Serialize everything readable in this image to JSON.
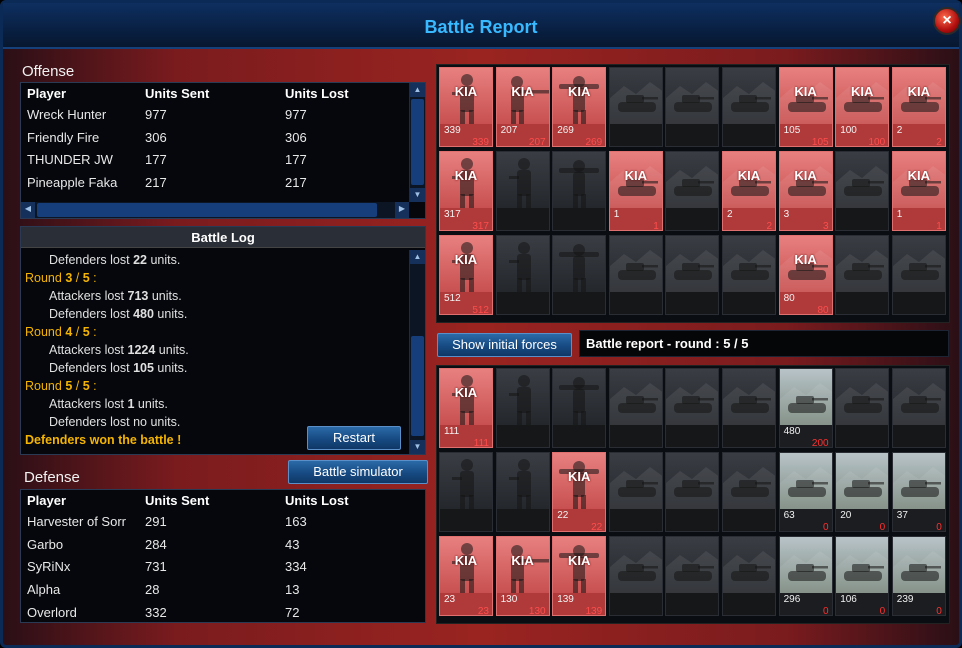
{
  "window": {
    "title": "Battle Report",
    "close_label": "×"
  },
  "offense": {
    "label": "Offense",
    "columns": [
      "Player",
      "Units Sent",
      "Units Lost"
    ],
    "rows": [
      [
        "Wreck Hunter",
        "977",
        "977"
      ],
      [
        "Friendly Fire",
        "306",
        "306"
      ],
      [
        "THUNDER JW",
        "177",
        "177"
      ],
      [
        "Pineapple Faka",
        "217",
        "217"
      ]
    ]
  },
  "battle_log": {
    "title": "Battle Log",
    "lines": [
      {
        "kind": "ind",
        "pre": "Defenders lost ",
        "num": "22",
        "post": " units."
      },
      {
        "kind": "rnd",
        "pre": "Round ",
        "num": "3",
        "mid": " / ",
        "num2": "5",
        "post": " :"
      },
      {
        "kind": "ind",
        "pre": "Attackers lost ",
        "num": "713",
        "post": " units."
      },
      {
        "kind": "ind",
        "pre": "Defenders lost ",
        "num": "480",
        "post": " units."
      },
      {
        "kind": "rnd",
        "pre": "Round ",
        "num": "4",
        "mid": " / ",
        "num2": "5",
        "post": " :"
      },
      {
        "kind": "ind",
        "pre": "Attackers lost ",
        "num": "1224",
        "post": " units."
      },
      {
        "kind": "ind",
        "pre": "Defenders lost ",
        "num": "105",
        "post": " units."
      },
      {
        "kind": "rnd",
        "pre": "Round ",
        "num": "5",
        "mid": " / ",
        "num2": "5",
        "post": " :"
      },
      {
        "kind": "ind",
        "pre": "Attackers lost ",
        "num": "1",
        "post": " units."
      },
      {
        "kind": "ind",
        "pre": "Defenders lost no units.",
        "num": "",
        "post": ""
      },
      {
        "kind": "win",
        "pre": "Defenders won the battle !",
        "num": "",
        "post": ""
      }
    ],
    "restart_label": "Restart"
  },
  "battle_simulator_label": "Battle simulator",
  "defense": {
    "label": "Defense",
    "columns": [
      "Player",
      "Units Sent",
      "Units Lost"
    ],
    "rows": [
      [
        "Harvester of Sorr",
        "291",
        "163"
      ],
      [
        "Garbo",
        "284",
        "43"
      ],
      [
        "SyRiNx",
        "731",
        "334"
      ],
      [
        "Alpha",
        "28",
        "13"
      ],
      [
        "Overlord",
        "332",
        "72"
      ]
    ]
  },
  "show_initial_label": "Show initial forces",
  "report_title": "Battle report - round : 5 / 5",
  "kia_label": "KIA",
  "attacker_units": [
    {
      "type": "infantry",
      "kia": true,
      "total": "339",
      "lost": "339"
    },
    {
      "type": "rifle",
      "kia": true,
      "total": "207",
      "lost": "207"
    },
    {
      "type": "rocket",
      "kia": true,
      "total": "269",
      "lost": "269"
    },
    {
      "type": "tank",
      "kia": false,
      "total": "",
      "lost": ""
    },
    {
      "type": "tank",
      "kia": false,
      "total": "",
      "lost": ""
    },
    {
      "type": "tank",
      "kia": false,
      "total": "",
      "lost": ""
    },
    {
      "type": "tank",
      "kia": true,
      "total": "105",
      "lost": "105"
    },
    {
      "type": "tank",
      "kia": true,
      "total": "100",
      "lost": "100"
    },
    {
      "type": "tank",
      "kia": true,
      "total": "2",
      "lost": "2"
    },
    {
      "type": "infantry",
      "kia": true,
      "total": "317",
      "lost": "317"
    },
    {
      "type": "infantry",
      "kia": false,
      "total": "",
      "lost": ""
    },
    {
      "type": "rocket",
      "kia": false,
      "total": "",
      "lost": ""
    },
    {
      "type": "tank",
      "kia": true,
      "total": "1",
      "lost": "1"
    },
    {
      "type": "tank",
      "kia": false,
      "total": "",
      "lost": ""
    },
    {
      "type": "tank",
      "kia": true,
      "total": "2",
      "lost": "2"
    },
    {
      "type": "tank",
      "kia": true,
      "total": "3",
      "lost": "3"
    },
    {
      "type": "tank",
      "kia": false,
      "total": "",
      "lost": ""
    },
    {
      "type": "tank",
      "kia": true,
      "total": "1",
      "lost": "1"
    },
    {
      "type": "infantry",
      "kia": true,
      "total": "512",
      "lost": "512"
    },
    {
      "type": "infantry",
      "kia": false,
      "total": "",
      "lost": ""
    },
    {
      "type": "rocket",
      "kia": false,
      "total": "",
      "lost": ""
    },
    {
      "type": "tank",
      "kia": false,
      "total": "",
      "lost": ""
    },
    {
      "type": "tank",
      "kia": false,
      "total": "",
      "lost": ""
    },
    {
      "type": "tank",
      "kia": false,
      "total": "",
      "lost": ""
    },
    {
      "type": "tank",
      "kia": true,
      "total": "80",
      "lost": "80"
    },
    {
      "type": "tank",
      "kia": false,
      "total": "",
      "lost": ""
    },
    {
      "type": "tank",
      "kia": false,
      "total": "",
      "lost": ""
    }
  ],
  "defender_units": [
    {
      "type": "infantry",
      "kia": true,
      "total": "111",
      "lost": "111"
    },
    {
      "type": "infantry",
      "kia": false,
      "total": "",
      "lost": ""
    },
    {
      "type": "rocket",
      "kia": false,
      "total": "",
      "lost": ""
    },
    {
      "type": "tank",
      "kia": false,
      "total": "",
      "lost": ""
    },
    {
      "type": "tank",
      "kia": false,
      "total": "",
      "lost": ""
    },
    {
      "type": "tank",
      "kia": false,
      "total": "",
      "lost": ""
    },
    {
      "type": "tank",
      "kia": false,
      "alive": true,
      "total": "480",
      "lost": "200"
    },
    {
      "type": "tank",
      "kia": false,
      "total": "",
      "lost": ""
    },
    {
      "type": "tank",
      "kia": false,
      "total": "",
      "lost": ""
    },
    {
      "type": "infantry",
      "kia": false,
      "total": "",
      "lost": ""
    },
    {
      "type": "infantry",
      "kia": false,
      "total": "",
      "lost": ""
    },
    {
      "type": "rocket",
      "kia": true,
      "total": "22",
      "lost": "22"
    },
    {
      "type": "tank",
      "kia": false,
      "total": "",
      "lost": ""
    },
    {
      "type": "tank",
      "kia": false,
      "total": "",
      "lost": ""
    },
    {
      "type": "tank",
      "kia": false,
      "total": "",
      "lost": ""
    },
    {
      "type": "tank",
      "kia": false,
      "alive": true,
      "total": "63",
      "lost": "0"
    },
    {
      "type": "tank",
      "kia": false,
      "alive": true,
      "total": "20",
      "lost": "0"
    },
    {
      "type": "tank",
      "kia": false,
      "alive": true,
      "total": "37",
      "lost": "0"
    },
    {
      "type": "infantry",
      "kia": true,
      "total": "23",
      "lost": "23"
    },
    {
      "type": "rifle",
      "kia": true,
      "total": "130",
      "lost": "130"
    },
    {
      "type": "rocket",
      "kia": true,
      "total": "139",
      "lost": "139"
    },
    {
      "type": "tank",
      "kia": false,
      "total": "",
      "lost": ""
    },
    {
      "type": "tank",
      "kia": false,
      "total": "",
      "lost": ""
    },
    {
      "type": "tank",
      "kia": false,
      "total": "",
      "lost": ""
    },
    {
      "type": "tank",
      "kia": false,
      "alive": true,
      "total": "296",
      "lost": "0"
    },
    {
      "type": "tank",
      "kia": false,
      "alive": true,
      "total": "106",
      "lost": "0"
    },
    {
      "type": "tank",
      "kia": false,
      "alive": true,
      "total": "239",
      "lost": "0"
    }
  ]
}
